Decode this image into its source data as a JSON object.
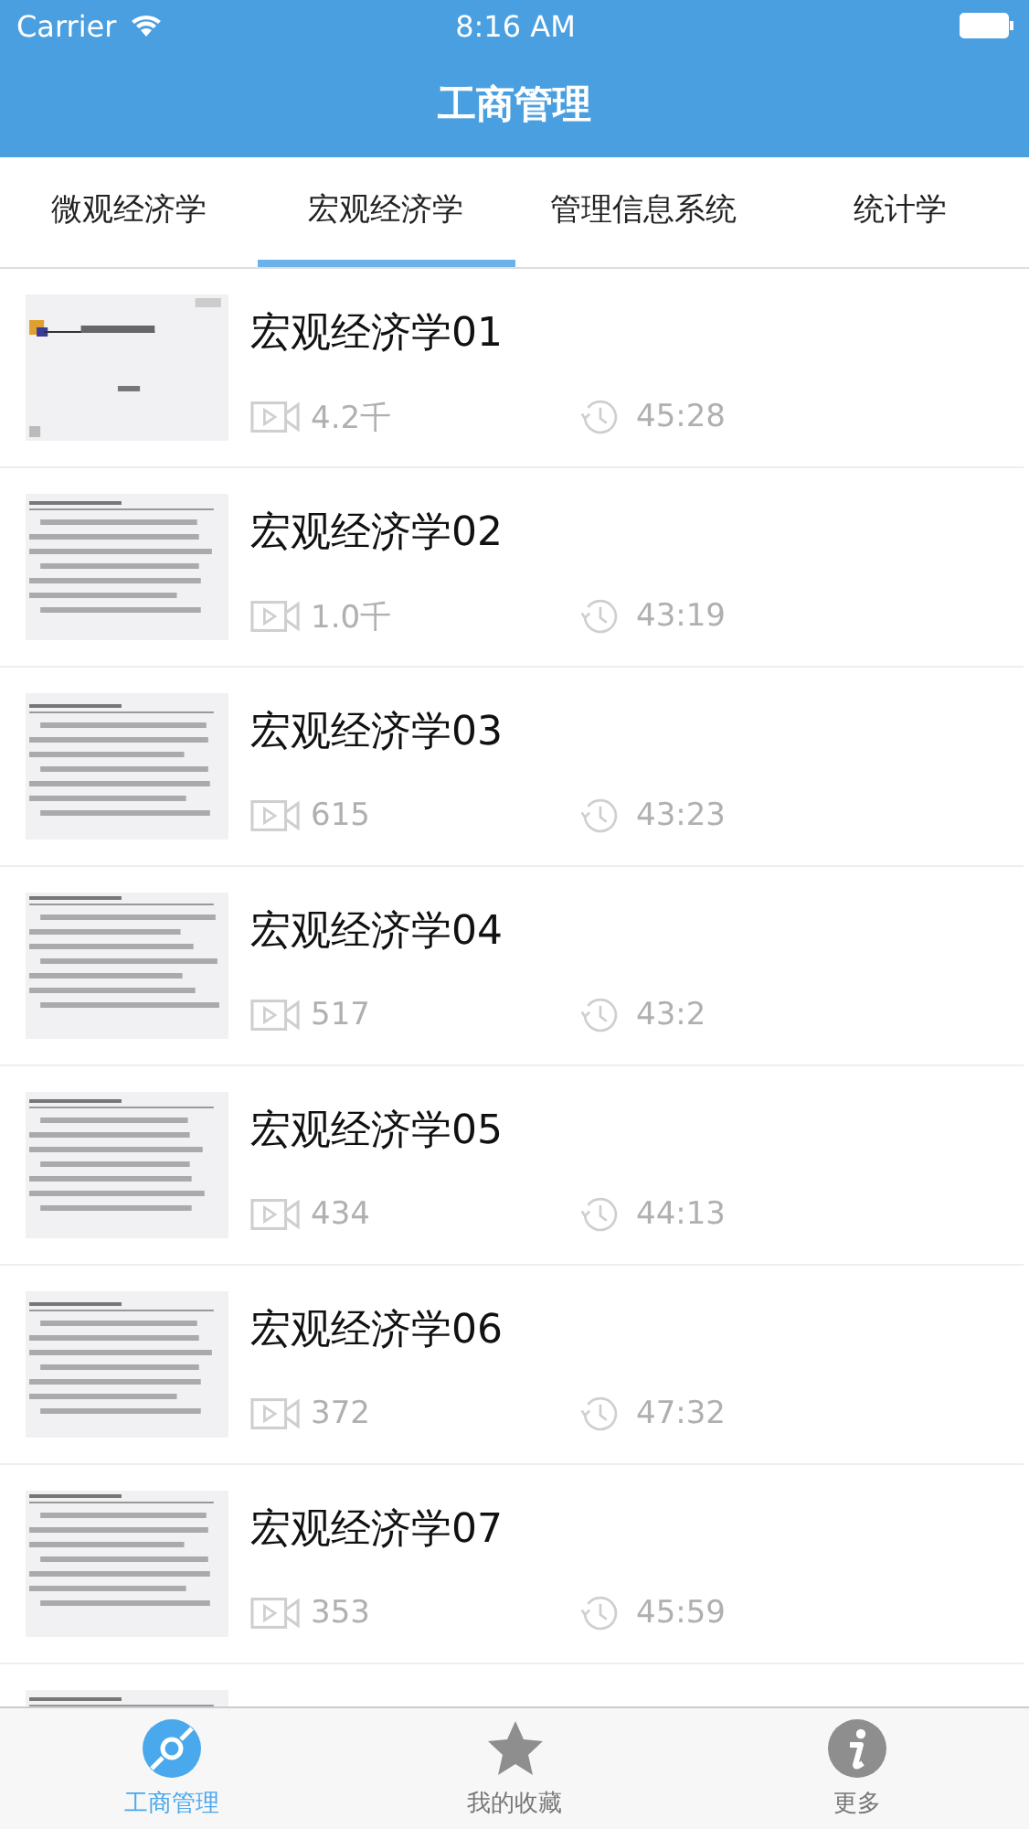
{
  "status_bar": {
    "carrier": "Carrier",
    "time": "8:16 AM"
  },
  "nav_bar": {
    "title": "工商管理"
  },
  "tabs": [
    {
      "label": "微观经济学",
      "selected": false
    },
    {
      "label": "宏观经济学",
      "selected": true
    },
    {
      "label": "管理信息系统",
      "selected": false
    },
    {
      "label": "统计学",
      "selected": false
    }
  ],
  "lessons": [
    {
      "title": "宏观经济学01",
      "views": "4.2千",
      "duration": "45:28"
    },
    {
      "title": "宏观经济学02",
      "views": "1.0千",
      "duration": "43:19"
    },
    {
      "title": "宏观经济学03",
      "views": "615",
      "duration": "43:23"
    },
    {
      "title": "宏观经济学04",
      "views": "517",
      "duration": "43:2"
    },
    {
      "title": "宏观经济学05",
      "views": "434",
      "duration": "44:13"
    },
    {
      "title": "宏观经济学06",
      "views": "372",
      "duration": "47:32"
    },
    {
      "title": "宏观经济学07",
      "views": "353",
      "duration": "45:59"
    },
    {
      "kind": "picture"
    }
  ],
  "tab_bar": [
    {
      "label": "工商管理",
      "kind": "disc",
      "selected": true
    },
    {
      "label": "我的收藏",
      "kind": "star",
      "selected": false
    },
    {
      "label": "更多",
      "kind": "info",
      "selected": false
    }
  ]
}
